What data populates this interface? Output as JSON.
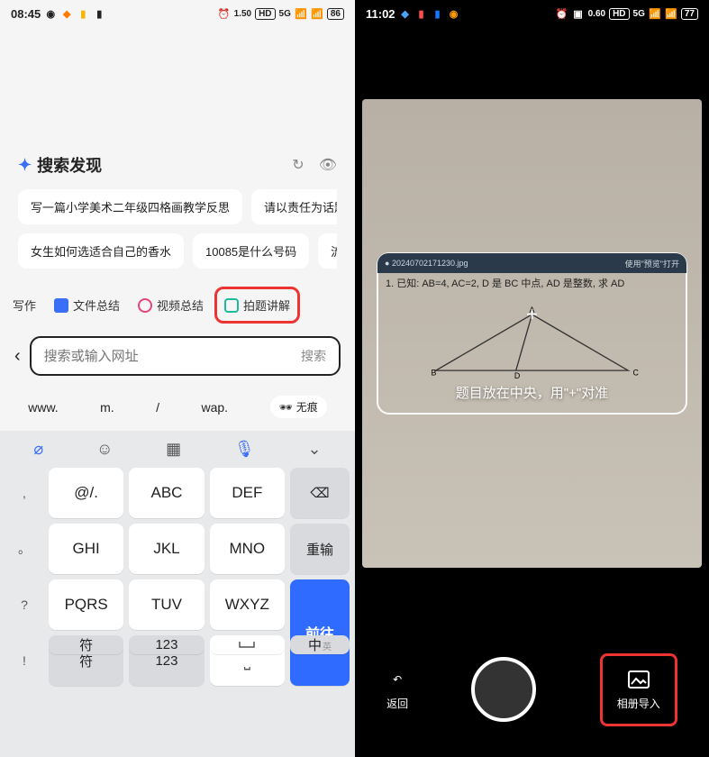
{
  "left": {
    "status": {
      "time": "08:45",
      "speed": "1.50",
      "speed_unit": "KB/s",
      "net": "5G",
      "battery": "86"
    },
    "discover": {
      "title": "搜索发现",
      "chips_row1": [
        "写一篇小学美术二年级四格画教学反思",
        "请以责任为话题写"
      ],
      "chips_row2": [
        "女生如何选适合自己的香水",
        "10085是什么号码",
        "流量"
      ]
    },
    "tabs": {
      "t0": "写作",
      "t1": "文件总结",
      "t2": "视频总结",
      "t3": "拍题讲解"
    },
    "search": {
      "placeholder": "搜索或输入网址",
      "button": "搜索"
    },
    "shortcuts": {
      "www": "www.",
      "m": "m.",
      "slash": "/",
      "wap": "wap.",
      "incog": "无痕"
    },
    "kb": {
      "side": [
        ",",
        "。",
        "?",
        "!"
      ],
      "r1": [
        "@/.",
        "ABC",
        "DEF"
      ],
      "r2": [
        "GHI",
        "JKL",
        "MNO"
      ],
      "r3": [
        "PQRS",
        "TUV",
        "WXYZ"
      ],
      "r4_sym": "符",
      "r4_num": "123",
      "r4_zh": "中",
      "r4_en": "英",
      "func_retype": "重输",
      "func_go": "前往"
    }
  },
  "right": {
    "status": {
      "time": "11:02",
      "speed": "0.60",
      "speed_unit": "KB/s",
      "net": "5G",
      "battery": "77"
    },
    "frame": {
      "filename": "20240702171230.jpg",
      "open_hint": "使用\"预览\"打开",
      "problem": "1. 已知: AB=4, AC=2, D 是 BC 中点, AD 是整数, 求 AD",
      "vA": "A",
      "vB": "B",
      "vC": "C",
      "vD": "D",
      "hint": "题目放在中央，用\"+\"对准"
    },
    "bottom": {
      "back": "返回",
      "album": "相册导入"
    }
  }
}
